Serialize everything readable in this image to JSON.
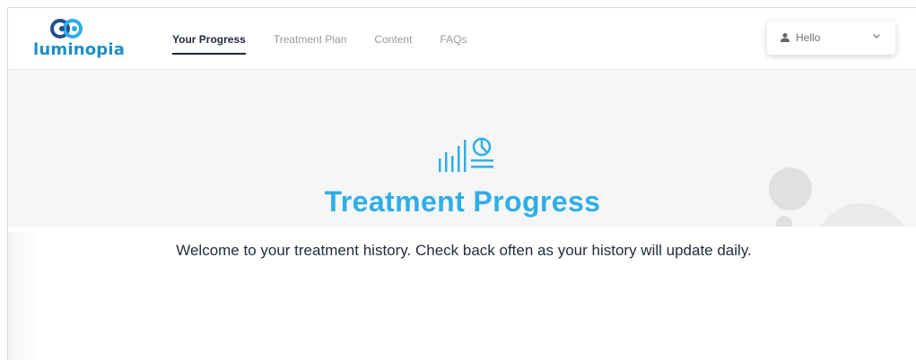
{
  "brand": {
    "logo_text": "luminopia"
  },
  "nav": {
    "items": [
      {
        "label": "Your Progress",
        "active": true
      },
      {
        "label": "Treatment Plan",
        "active": false
      },
      {
        "label": "Content",
        "active": false
      },
      {
        "label": "FAQs",
        "active": false
      }
    ]
  },
  "user_menu": {
    "label": "Hello",
    "icon": "user-icon"
  },
  "hero": {
    "title": "Treatment Progress",
    "text": "Welcome to your treatment history. Check back often as your history will update daily.",
    "icon": "chart-progress-icon"
  },
  "colors": {
    "accent": "#2eaee7",
    "nav_active": "#1f2740",
    "nav_inactive": "#9a9a9a",
    "logo": "#1c8fc7"
  }
}
